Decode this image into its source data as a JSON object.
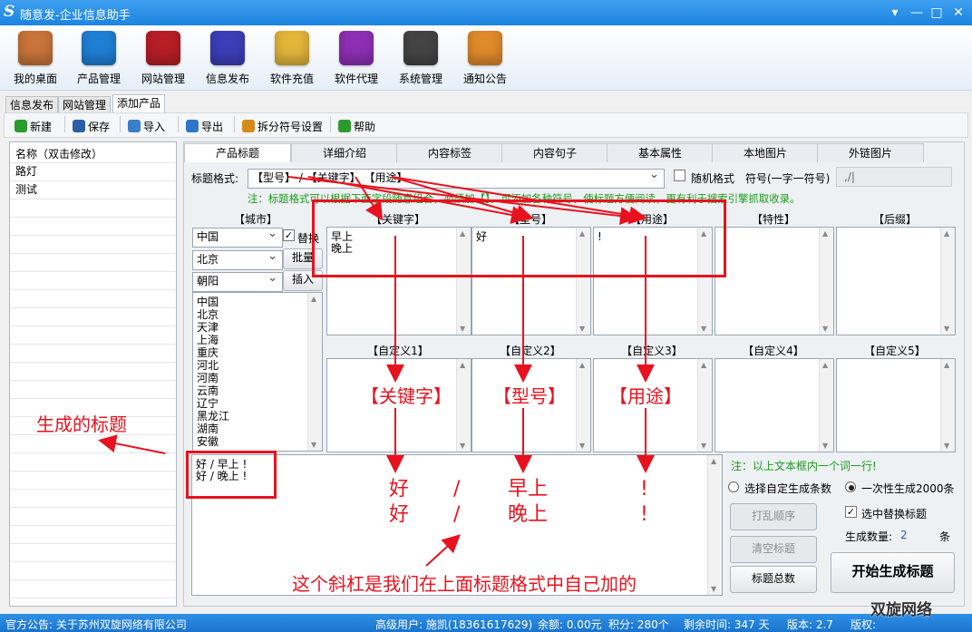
{
  "window": {
    "title": "随意发-企业信息助手"
  },
  "toolbar": [
    {
      "label": "我的桌面",
      "icon": "house-icon",
      "color": "#c8743a"
    },
    {
      "label": "产品管理",
      "icon": "cloud-icon",
      "color": "#1f7fd6"
    },
    {
      "label": "网站管理",
      "icon": "building-icon",
      "color": "#b81e26"
    },
    {
      "label": "信息发布",
      "icon": "magic-wand-icon",
      "color": "#3b3fb8"
    },
    {
      "label": "软件充值",
      "icon": "money-chart-icon",
      "color": "#e3b53a"
    },
    {
      "label": "软件代理",
      "icon": "gift-box-icon",
      "color": "#8e2fb5"
    },
    {
      "label": "系统管理",
      "icon": "gear-icon",
      "color": "#444444"
    },
    {
      "label": "通知公告",
      "icon": "notice-board-icon",
      "color": "#e08a2a"
    }
  ],
  "tabs": [
    "信息发布",
    "网站管理",
    "添加产品"
  ],
  "actions": [
    {
      "label": "新建",
      "icon": "plus-icon",
      "color": "#2b9b2b"
    },
    {
      "label": "保存",
      "icon": "save-icon",
      "color": "#2c5ea8"
    },
    {
      "label": "导入",
      "icon": "folder-icon",
      "color": "#3a7fc8"
    },
    {
      "label": "导出",
      "icon": "export-icon",
      "color": "#2c76c9"
    },
    {
      "label": "拆分符号设置",
      "icon": "split-icon",
      "color": "#d68a1a"
    },
    {
      "label": "帮助",
      "icon": "help-icon",
      "color": "#2b9b2b"
    }
  ],
  "left": {
    "header": "名称（双击修改）",
    "items": [
      "路灯",
      "测试"
    ]
  },
  "ptabs": [
    "产品标题",
    "详细介绍",
    "内容标签",
    "内容句子",
    "基本属性",
    "本地图片",
    "外链图片"
  ],
  "format": {
    "label": "标题格式:",
    "value": "【型号】 / 【关键字】 【用途】",
    "random_label": "随机格式",
    "symbol_label": "符号(一字一符号)",
    "symbol_value": ",/|",
    "note": "注：标题格式可以根据下面字段随意组合，必须加【】。可添加各种符号，使标题方便阅读，更有利于搜索引擎抓取收录。"
  },
  "city": {
    "header": "【城市】",
    "country": "中国",
    "province": "北京",
    "district": "朝阳",
    "replace_label": "替换",
    "batch_label": "批量",
    "insert_label": "插入",
    "list": [
      "中国",
      "北京",
      "天津",
      "上海",
      "重庆",
      "河北",
      "河南",
      "云南",
      "辽宁",
      "黑龙江",
      "湖南",
      "安徽"
    ]
  },
  "fields_row1": [
    {
      "header": "【关键字】",
      "content": "早上\n晚上"
    },
    {
      "header": "【型号】",
      "content": "好"
    },
    {
      "header": "【用途】",
      "content": "!"
    },
    {
      "header": "【特性】",
      "content": ""
    },
    {
      "header": "【后缀】",
      "content": ""
    }
  ],
  "fields_row2": [
    {
      "header": "【自定义1】",
      "content": ""
    },
    {
      "header": "【自定义2】",
      "content": ""
    },
    {
      "header": "【自定义3】",
      "content": ""
    },
    {
      "header": "【自定义4】",
      "content": ""
    },
    {
      "header": "【自定义5】",
      "content": ""
    }
  ],
  "output": {
    "lines": "好 / 早上 !\n好 / 晚上 !"
  },
  "controls": {
    "note": "注：以上文本框内一个词一行!",
    "radio_custom": "选择自定生成条数",
    "radio_once": "一次性生成2000条",
    "check_replace": "选中替换标题",
    "shuffle": "打乱顺序",
    "clear": "清空标题",
    "total": "标题总数",
    "count_label": "生成数量:",
    "count_value": "2",
    "count_unit": "条",
    "generate": "开始生成标题"
  },
  "annotations": {
    "generated_title": "生成的标题",
    "kw": "【关键字】",
    "model": "【型号】",
    "use": "【用途】",
    "slash_note": "这个斜杠是我们在上面标题格式中自己加的",
    "res_model": "好\n好",
    "res_slash": "/\n/",
    "res_kw": "早上\n晚上",
    "res_use": "!\n!"
  },
  "status": {
    "notice": "官方公告: 关于苏州双旋网络有限公司",
    "user": "高级用户: 施凯(18361617629)",
    "balance": "余额: 0.00元",
    "points": "积分: 280个",
    "remaining": "剩余时间: 347 天",
    "version": "版本: 2.7",
    "copyright": "版权:",
    "watermark": "双旋网络"
  }
}
